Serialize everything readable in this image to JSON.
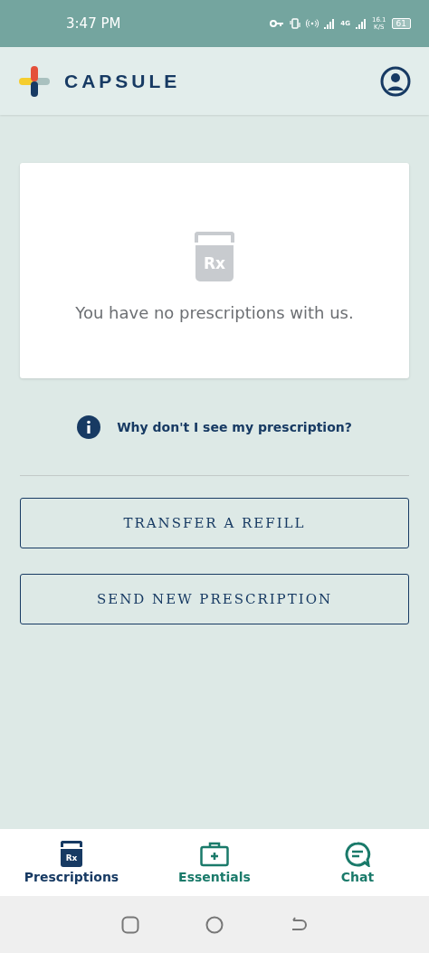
{
  "status_bar": {
    "time": "3:47 PM",
    "network": "4G",
    "speed": "16.1",
    "speed_unit": "K/S",
    "battery": "61"
  },
  "header": {
    "brand": "CAPSULE"
  },
  "empty_card": {
    "icon_text": "Rx",
    "message": "You have no prescriptions with us."
  },
  "help_link": "Why don't I see my prescription?",
  "buttons": [
    "TRANSFER A REFILL",
    "SEND NEW PRESCRIPTION"
  ],
  "tabs": [
    {
      "kind": "prescriptions",
      "label": "Prescriptions",
      "icon_text": "Rx",
      "selected": true
    },
    {
      "kind": "essentials",
      "label": "Essentials",
      "selected": false
    },
    {
      "kind": "chat",
      "label": "Chat",
      "selected": false
    }
  ]
}
